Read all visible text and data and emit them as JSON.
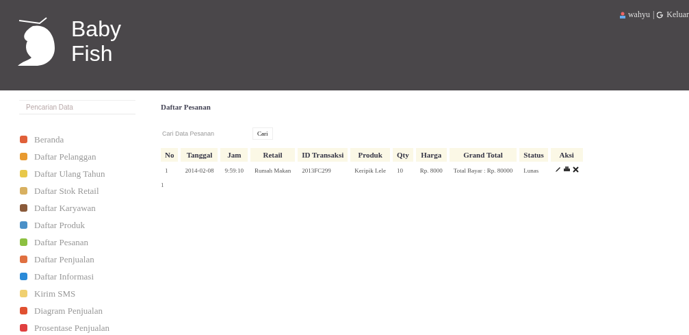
{
  "header": {
    "logo_top": "Baby",
    "logo_bottom": "Fish",
    "user": "wahyu",
    "separator": "|",
    "logout": "Keluar"
  },
  "sidebar": {
    "search": {
      "placeholder": "Pencarian Data"
    },
    "items": [
      {
        "label": "Beranda",
        "color": "#e0603a"
      },
      {
        "label": "Daftar Pelanggan",
        "color": "#e89a30"
      },
      {
        "label": "Daftar Ulang Tahun",
        "color": "#e8c84a"
      },
      {
        "label": "Daftar Stok Retail",
        "color": "#d8b060"
      },
      {
        "label": "Daftar Karyawan",
        "color": "#8a5a3a"
      },
      {
        "label": "Daftar Produk",
        "color": "#4a90c8"
      },
      {
        "label": "Daftar Pesanan",
        "color": "#8cc040"
      },
      {
        "label": "Daftar Penjualan",
        "color": "#e07040"
      },
      {
        "label": "Daftar Informasi",
        "color": "#2a8ad8"
      },
      {
        "label": "Kirim SMS",
        "color": "#f0d070"
      },
      {
        "label": "Diagram Penjualan",
        "color": "#e05030"
      },
      {
        "label": "Prosentase Penjualan",
        "color": "#e04040"
      }
    ]
  },
  "main": {
    "title": "Daftar Pesanan",
    "search": {
      "placeholder": "Cari Data Pesanan"
    },
    "search_button": "Cari",
    "table": {
      "columns": [
        "No",
        "Tanggal",
        "Jam",
        "Retail",
        "ID Transaksi",
        "Produk",
        "Qty",
        "Harga",
        "Grand Total",
        "Status",
        "Aksi"
      ],
      "rows": [
        {
          "cells": [
            "1",
            "2014-02-08",
            "9:59:10",
            "Rumah Makan",
            "2013FC299",
            "Keripik Lele",
            "10",
            "Rp. 8000",
            "Total Bayar : Rp. 80000",
            "Lunas"
          ]
        }
      ]
    },
    "pagination": "1"
  }
}
